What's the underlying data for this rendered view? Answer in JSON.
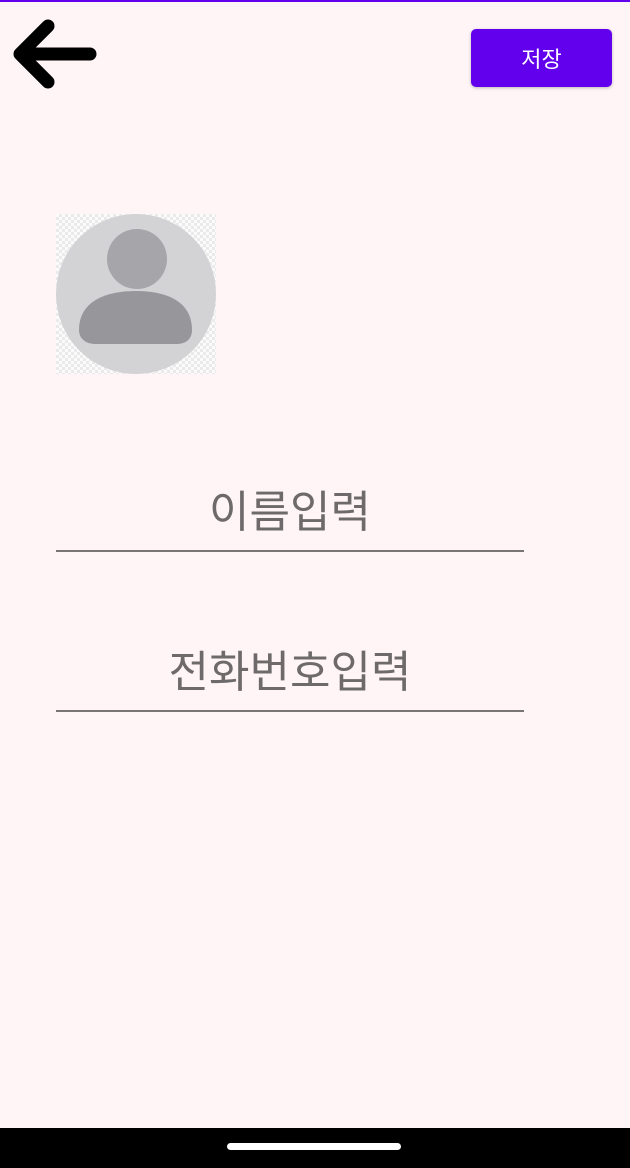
{
  "header": {
    "back_icon": "arrow-left-icon",
    "save_label": "저장"
  },
  "profile": {
    "avatar_icon": "person-placeholder-icon"
  },
  "form": {
    "name_placeholder": "이름입력",
    "name_value": "",
    "phone_placeholder": "전화번호입력",
    "phone_value": ""
  },
  "colors": {
    "accent": "#6200EE",
    "background": "#FFF5F6",
    "underline": "#7A7575",
    "placeholder": "#6E6A6B"
  }
}
